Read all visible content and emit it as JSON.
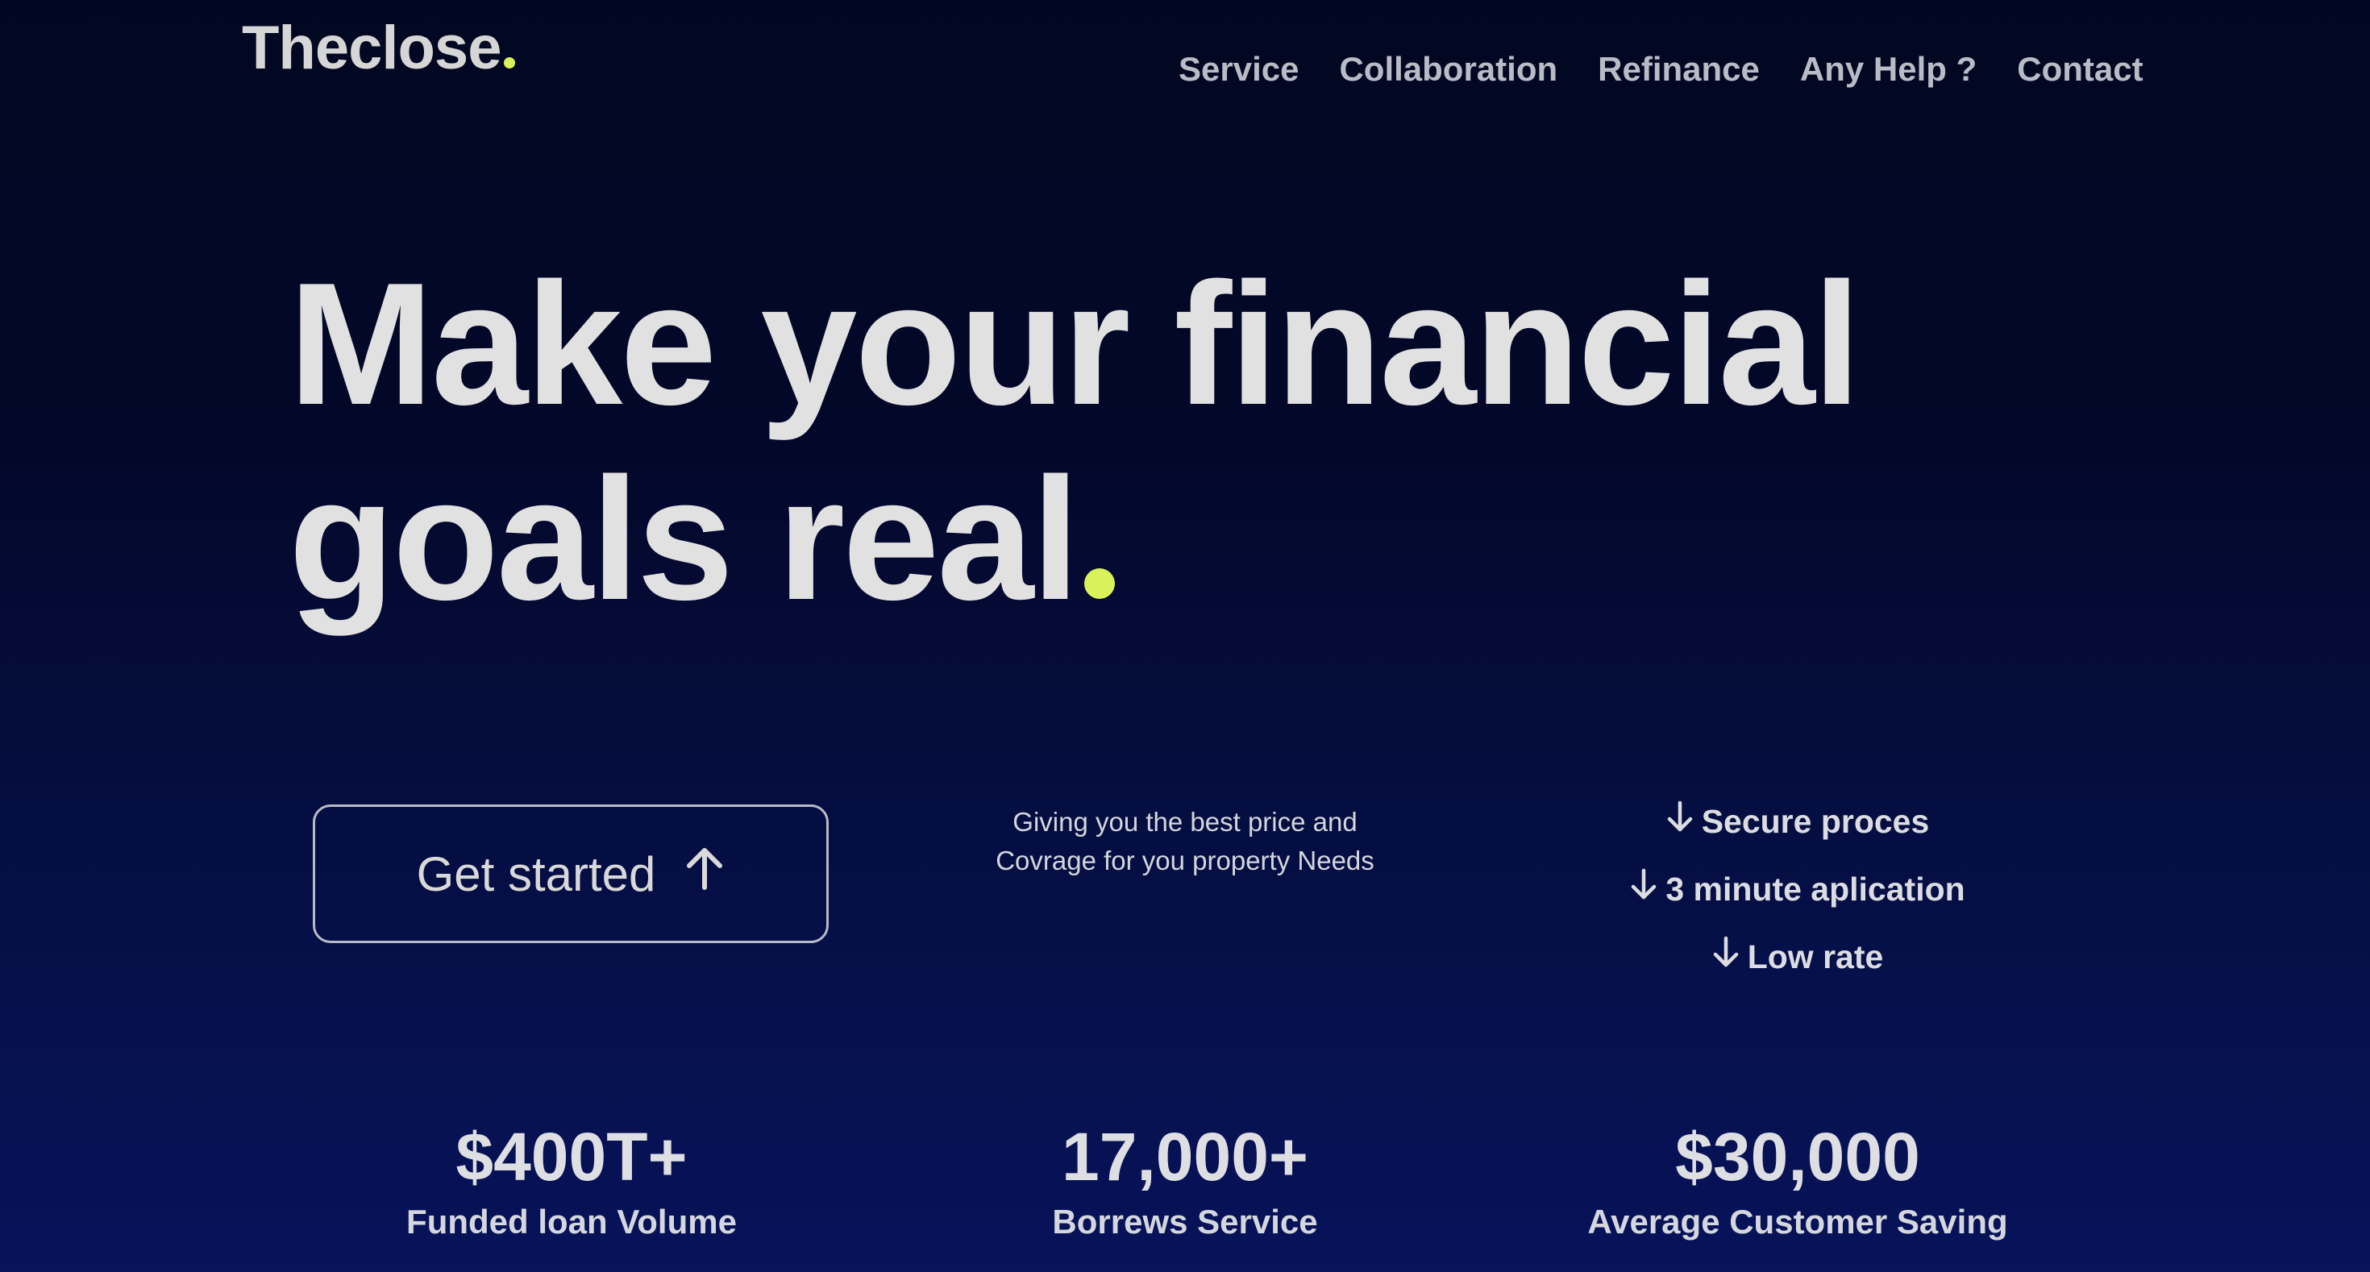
{
  "brand": {
    "name": "Theclose",
    "accent_color": "#d9f25a"
  },
  "nav": {
    "items": [
      {
        "label": "Service"
      },
      {
        "label": "Collaboration"
      },
      {
        "label": "Refinance"
      },
      {
        "label": "Any Help ?"
      },
      {
        "label": "Contact"
      }
    ]
  },
  "hero": {
    "line1": "Make your financial",
    "line2": "goals real"
  },
  "cta": {
    "label": "Get started",
    "icon": "arrow-up-icon"
  },
  "tagline": {
    "text": "Giving you the best price and Covrage for you property Needs"
  },
  "features": {
    "icon": "arrow-down-icon",
    "items": [
      {
        "label": "Secure proces"
      },
      {
        "label": "3 minute aplication"
      },
      {
        "label": "Low rate"
      }
    ]
  },
  "stats": [
    {
      "value": "$400T+",
      "label": "Funded loan Volume"
    },
    {
      "value": "17,000+",
      "label": "Borrews Service"
    },
    {
      "value": "$30,000",
      "label": "Average Customer Saving"
    }
  ]
}
